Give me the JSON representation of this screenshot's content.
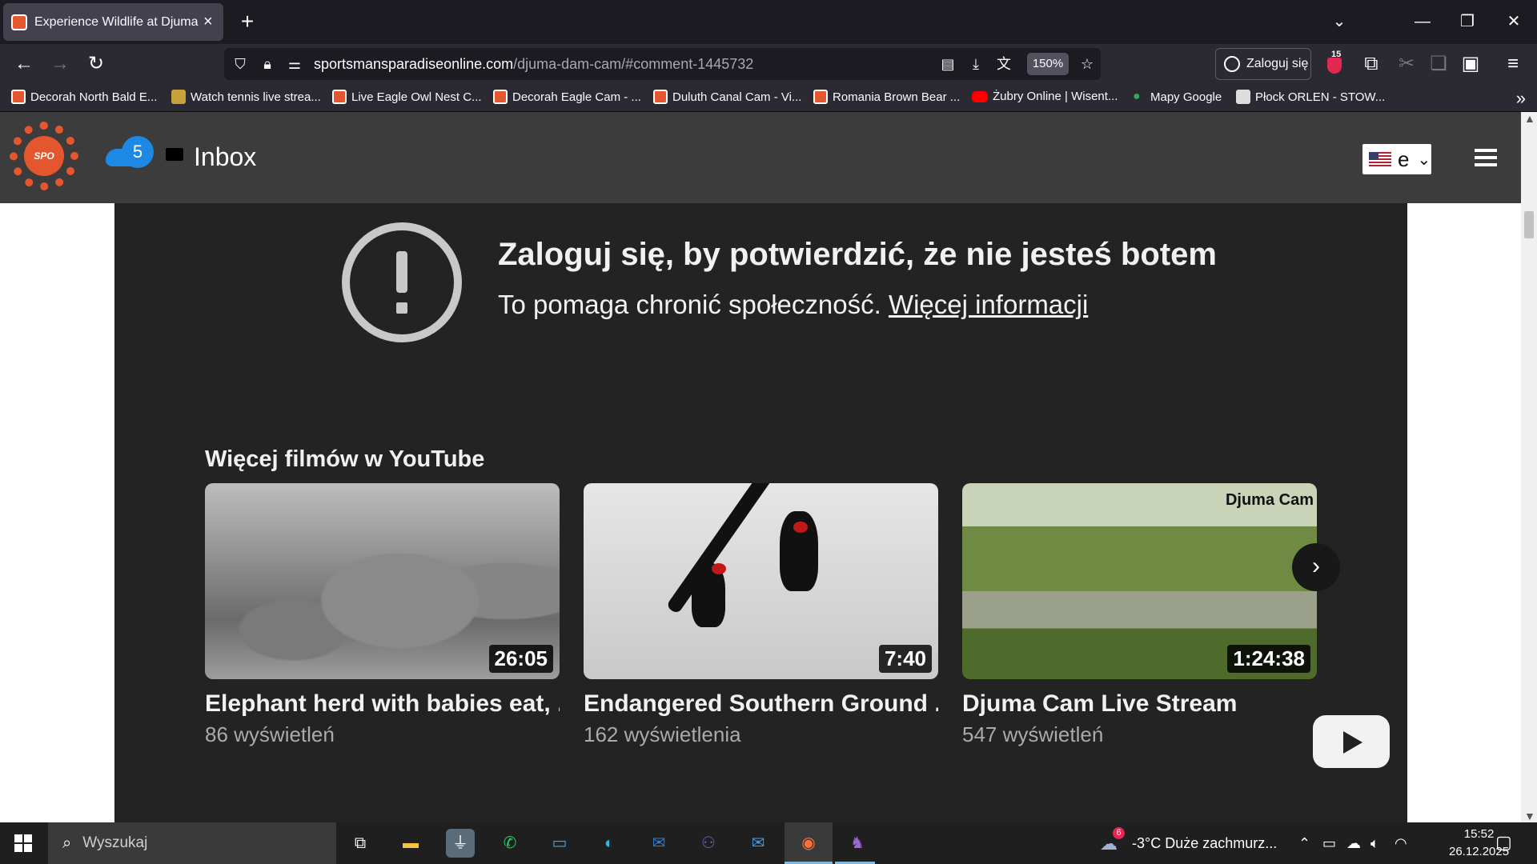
{
  "browser": {
    "tab_title": "Experience Wildlife at Djuma Dam",
    "url_host": "sportsmansparadiseonline.com",
    "url_path": "/djuma-dam-cam/#comment-1445732",
    "zoom": "150%",
    "login_label": "Zaloguj się",
    "extension_badge": "15",
    "bookmarks": [
      "Decorah North Bald E...",
      "Watch tennis live strea...",
      "Live Eagle Owl Nest C...",
      "Decorah Eagle Cam - ...",
      "Duluth Canal Cam - Vi...",
      "Romania Brown Bear ...",
      "Żubry Online | Wisent...",
      "Mapy Google",
      "Płock ORLEN - STOW..."
    ]
  },
  "site": {
    "logo_text": "SPO",
    "notification_count": "5",
    "inbox_label": "Inbox",
    "language": "e"
  },
  "embed": {
    "alert_title": "Zaloguj się, by potwierdzić, że nie jesteś botem",
    "alert_text": "To pomaga chronić społeczność.",
    "alert_link": "Więcej informacji",
    "more_videos_title": "Więcej filmów w YouTube",
    "videos": [
      {
        "title": "Elephant herd with babies eat, ...",
        "views": "86 wyświetleń",
        "duration": "26:05"
      },
      {
        "title": "Endangered Southern Ground ...",
        "views": "162 wyświetlenia",
        "duration": "7:40"
      },
      {
        "title": "Djuma Cam Live Stream",
        "views": "547 wyświetleń",
        "duration": "1:24:38",
        "brand": "Djuma Cam"
      }
    ]
  },
  "taskbar": {
    "search_placeholder": "Wyszukaj",
    "weather_badge": "6",
    "weather": "-3°C  Duże zachmurz...",
    "time": "15:52",
    "date": "26.12.2025"
  }
}
